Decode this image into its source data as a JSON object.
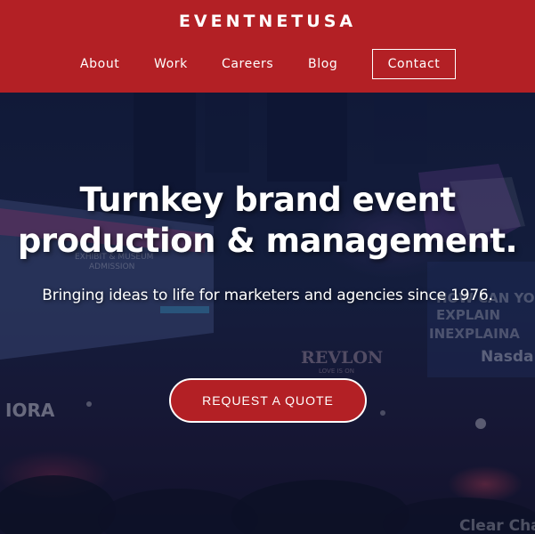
{
  "header": {
    "brand": "EVENTNETUSA",
    "nav": {
      "about": "About",
      "work": "Work",
      "careers": "Careers",
      "blog": "Blog",
      "contact": "Contact"
    }
  },
  "hero": {
    "headline_line1": "Turnkey brand event",
    "headline_line2": "production & management.",
    "subheadline": "Bringing ideas to life for marketers and agencies since 1976.",
    "cta_label": "REQUEST A QUOTE",
    "background_signs": {
      "sign_ora": "IORA",
      "sign_revlon": "REVLON",
      "sign_revlon_tag": "LOVE IS ON",
      "sign_nasdaq": "Nasda",
      "sign_clear": "Clear Cha",
      "sign_exhibit_line1": "EXHIBIT & MUSEUM",
      "sign_exhibit_line2": "ADMISSION",
      "sign_how_line1": "HOW CAN YO",
      "sign_how_line2": "EXPLAIN",
      "sign_how_line3": "INEXPLAINA"
    }
  },
  "colors": {
    "brand_red": "#b32025",
    "hero_overlay": "#121b3a",
    "text": "#ffffff"
  }
}
